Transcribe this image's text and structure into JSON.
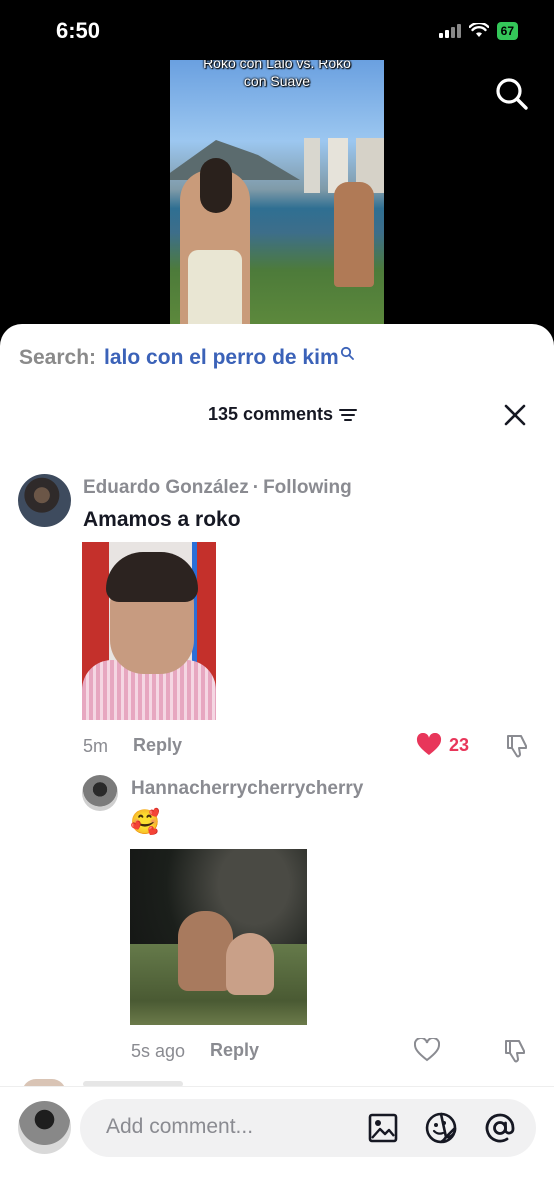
{
  "status_bar": {
    "time": "6:50",
    "battery": "67"
  },
  "video": {
    "caption_line1": "Roko con Lalo vs. Roko",
    "caption_line2": "con Suave"
  },
  "search": {
    "prefix": "Search:",
    "query": "lalo con el perro de kim"
  },
  "comments_header": {
    "count_label": "135 comments"
  },
  "comments": [
    {
      "author": "Eduardo González",
      "relation": "Following",
      "text": "Amamos a roko",
      "time": "5m",
      "reply_label": "Reply",
      "likes": "23",
      "liked": true
    },
    {
      "author": "Hannacherrycherrycherry",
      "text": "🥰",
      "time": "5s ago",
      "reply_label": "Reply",
      "liked": false
    }
  ],
  "composer": {
    "placeholder": "Add comment..."
  },
  "icons": {
    "top_search": "search-icon",
    "filter": "filter-icon",
    "close": "close-icon",
    "like": "heart-icon",
    "dislike": "thumbs-down-icon",
    "image": "image-icon",
    "emoji": "sticker-icon",
    "mention": "at-sign-icon"
  },
  "colors": {
    "search_query": "#3b62b8",
    "like_active": "#e8365a",
    "battery": "#34c759"
  }
}
